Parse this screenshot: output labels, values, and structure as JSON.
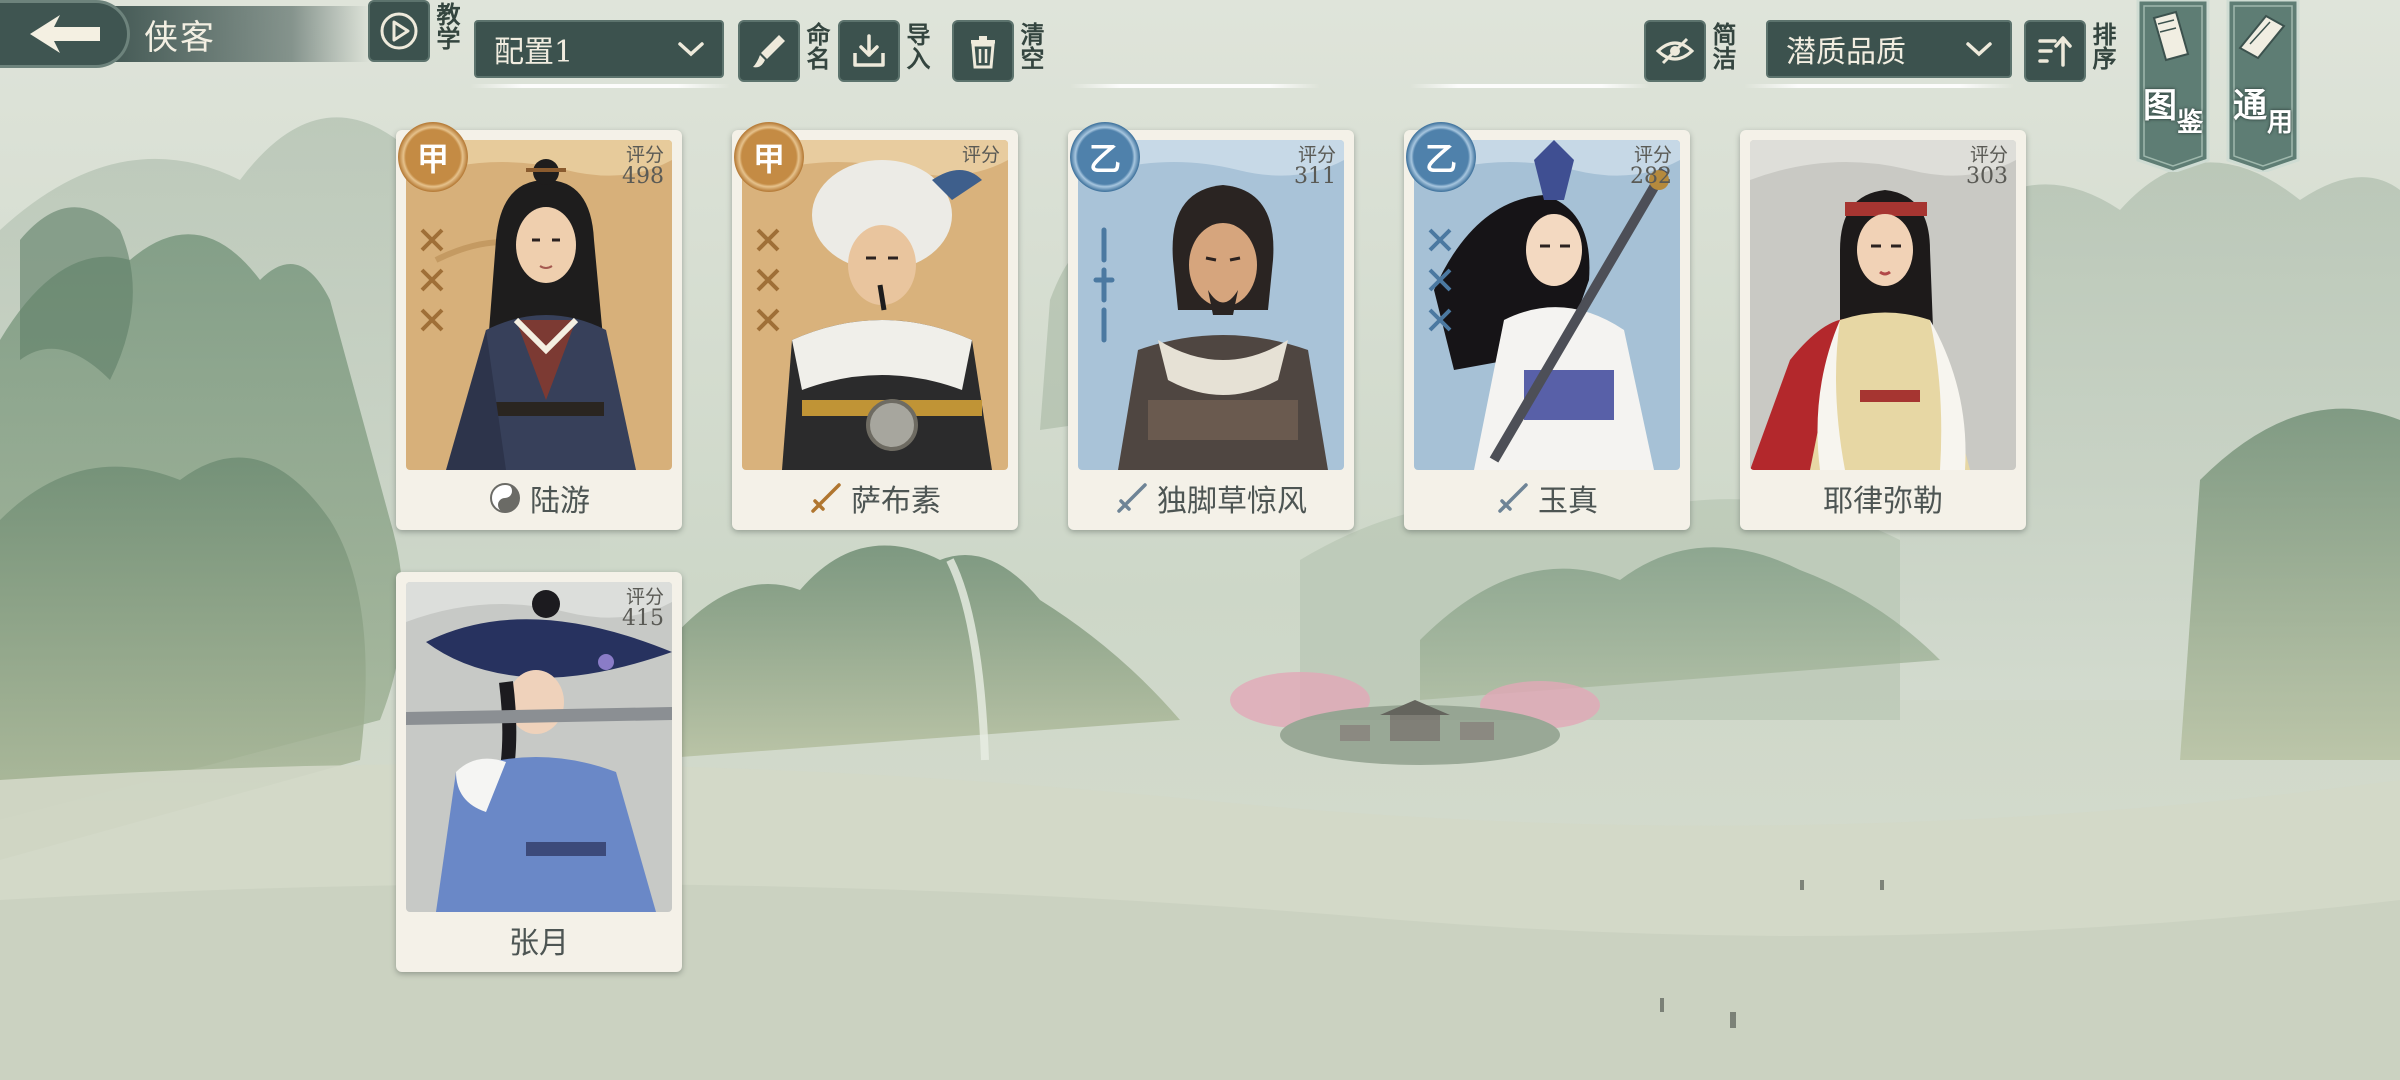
{
  "header": {
    "title": "侠客",
    "tutorial_label": "教学",
    "config_select": "配置1",
    "rename_label": "命名",
    "import_label": "导入",
    "clear_label": "清空",
    "simple_label": "简洁",
    "sort_select": "潜质品质",
    "sort_label": "排序",
    "codex_label_1": "图",
    "codex_label_2": "鉴",
    "general_label_1": "通",
    "general_label_2": "用"
  },
  "heroes": [
    {
      "name": "陆游",
      "score_label": "评分",
      "score": "498",
      "grade": "甲",
      "grade_tier": "gold",
      "element_icon": "yin-yang-icon"
    },
    {
      "name": "萨布素",
      "score_label": "评分",
      "score": "",
      "grade": "甲",
      "grade_tier": "gold",
      "element_icon": "sword-icon"
    },
    {
      "name": "独脚草惊风",
      "score_label": "评分",
      "score": "311",
      "grade": "乙",
      "grade_tier": "blue",
      "element_icon": "sword-icon"
    },
    {
      "name": "玉真",
      "score_label": "评分",
      "score": "282",
      "grade": "乙",
      "grade_tier": "blue",
      "element_icon": "sword-icon"
    },
    {
      "name": "耶律弥勒",
      "score_label": "评分",
      "score": "303",
      "grade": "",
      "grade_tier": "none",
      "element_icon": ""
    },
    {
      "name": "张月",
      "score_label": "评分",
      "score": "415",
      "grade": "",
      "grade_tier": "none",
      "element_icon": ""
    }
  ],
  "colors": {
    "button_bg": "#3c524e",
    "gold_card_bg": "#d7b07a",
    "blue_card_bg": "#a9c3d8",
    "gray_card_bg": "#c9c9c4"
  }
}
